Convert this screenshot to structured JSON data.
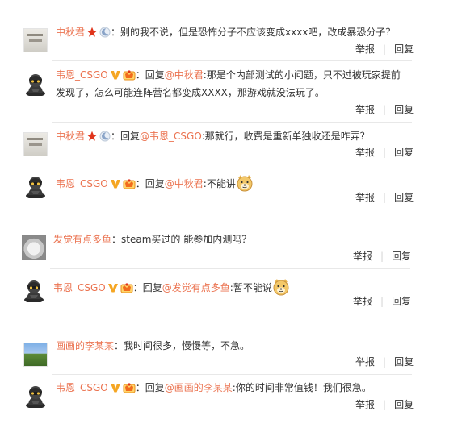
{
  "comments": [
    {
      "user": "中秋君",
      "avatar_kind": "chat",
      "text": "：别的我不说，但是恐怖分子不应该变成xxxx吧，改成暴恐分子？",
      "report_label": "举报",
      "reply_label": "回复"
    },
    {
      "user": "韦恩_CSGO",
      "avatar_kind": "soldier",
      "text_prefix": "：回复",
      "mention": "@中秋君",
      "text_line1": ":那是个内部测试的小问题，只不过被玩家提前",
      "text_line2": "发现了，怎么可能连阵营名都变成XXXX，那游戏就没法玩了。",
      "report_label": "举报",
      "reply_label": "回复"
    },
    {
      "user": "中秋君",
      "avatar_kind": "chat",
      "text_prefix": "：回复",
      "mention": "@韦恩_CSGO",
      "text": ":那就行，收费是重新单独收还是咋弄？",
      "report_label": "举报",
      "reply_label": "回复"
    },
    {
      "user": "韦恩_CSGO",
      "avatar_kind": "soldier",
      "text_prefix": "：回复",
      "mention": "@中秋君",
      "text": ":不能讲",
      "emoji": "doge-icon",
      "report_label": "举报",
      "reply_label": "回复"
    },
    {
      "user": "发觉有点多鱼",
      "avatar_kind": "pug",
      "text": "：steam买过的 能参加内测吗？",
      "report_label": "举报",
      "reply_label": "回复"
    },
    {
      "user": "韦恩_CSGO",
      "avatar_kind": "soldier",
      "text_prefix": "：回复",
      "mention": "@发觉有点多鱼",
      "text": ":暂不能说",
      "emoji": "doge-icon",
      "report_label": "举报",
      "reply_label": "回复"
    },
    {
      "user": "画画的李某某",
      "avatar_kind": "landscape",
      "text": "：我时间很多，慢慢等，不急。",
      "report_label": "举报",
      "reply_label": "回复"
    },
    {
      "user": "韦恩_CSGO",
      "avatar_kind": "soldier",
      "text_prefix": "：回复",
      "mention": "@画画的李某某",
      "text": ":你的时间非常值钱！我们很急。",
      "report_label": "举报",
      "reply_label": "回复"
    }
  ],
  "colors": {
    "username": "#eb7350",
    "text": "#333333",
    "divider": "#e8e8e8",
    "verified_v": "#f5a623"
  },
  "icons": {
    "star_badge": "red-star-icon",
    "moon_badge": "moon-badge-icon",
    "verified_badge": "verified-v-icon",
    "vip_badge": "vip-crown-icon",
    "emoji": "doge-icon"
  }
}
